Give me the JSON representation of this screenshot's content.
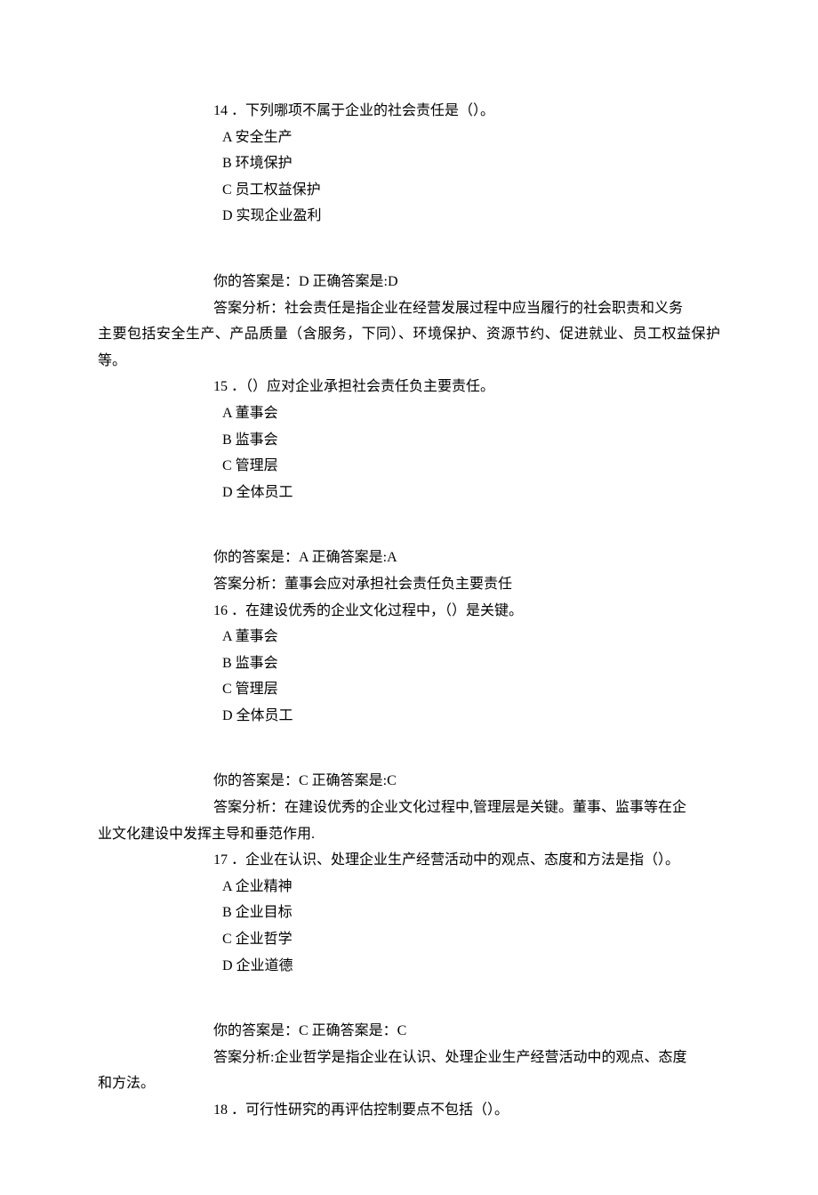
{
  "q14": {
    "number": "14 ．",
    "stem": "下列哪项不属于企业的社会责任是（）。",
    "opts": {
      "a": "A 安全生产",
      "b": "B 环境保护",
      "c": "C 员工权益保护",
      "d": "D 实现企业盈利"
    },
    "ans": "你的答案是：D 正确答案是:D",
    "analysis_lead": "答案分析：社会责任是指企业在经营发展过程中应当履行的社会职责和义务",
    "analysis_wrap": "主要包括安全生产、产品质量（含服务，下同）、环境保护、资源节约、促进就业、员工权益保护等。"
  },
  "q15": {
    "number": "15 ．",
    "stem": "（）应对企业承担社会责任负主要责任。",
    "opts": {
      "a": "A 董事会",
      "b": "B 监事会",
      "c": "C 管理层",
      "d": "D 全体员工"
    },
    "ans": "你的答案是：A 正确答案是:A",
    "analysis": "答案分析：董事会应对承担社会责任负主要责任"
  },
  "q16": {
    "number": "16 ．",
    "stem": "在建设优秀的企业文化过程中，（）是关键。",
    "opts": {
      "a": "A 董事会",
      "b": "B 监事会",
      "c": "C 管理层",
      "d": "D 全体员工"
    },
    "ans": "你的答案是：C 正确答案是:C",
    "analysis_lead": "答案分析：在建设优秀的企业文化过程中,管理层是关键。董事、监事等在企",
    "analysis_wrap": "业文化建设中发挥主导和垂范作用."
  },
  "q17": {
    "number": "17 ．",
    "stem": "企业在认识、处理企业生产经营活动中的观点、态度和方法是指（）。",
    "opts": {
      "a": "A 企业精神",
      "b": "B 企业目标",
      "c": "C 企业哲学",
      "d": "D 企业道德"
    },
    "ans": "你的答案是：C 正确答案是：C",
    "analysis_lead": "答案分析:企业哲学是指企业在认识、处理企业生产经营活动中的观点、态度",
    "analysis_wrap": "和方法。"
  },
  "q18": {
    "number": "18 ．",
    "stem": "可行性研究的再评估控制要点不包括（）。"
  }
}
